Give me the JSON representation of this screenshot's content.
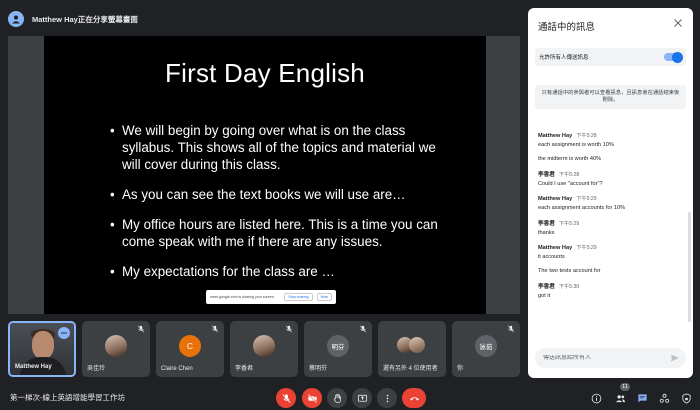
{
  "header": {
    "title": "Matthew Hay正在分享螢幕畫面"
  },
  "slide": {
    "title": "First Day English",
    "bullets": [
      "We will begin by going over what is on the class syllabus. This shows all of the topics and material we will cover during this class.",
      "As you can see the text books we will use are…",
      "My office hours are listed here. This is a time you can come speak with me if there are any issues.",
      "My expectations for the class are …"
    ],
    "share_bar": {
      "message": "meet.google.com is sharing your screen.",
      "stop_label": "Stop sharing",
      "hide_label": "Hide"
    }
  },
  "participants": [
    {
      "name": "Matthew Hay",
      "type": "video"
    },
    {
      "name": "吳佳玲",
      "type": "photo"
    },
    {
      "name": "Claire Chen",
      "type": "initial",
      "initial": "C",
      "color": "#e8710a"
    },
    {
      "name": "李香君",
      "type": "photo"
    },
    {
      "name": "蔡明芬",
      "type": "initial",
      "initial": "明芬",
      "color": "#5f6368"
    },
    {
      "name": "還有另外 4 位使用者",
      "type": "group"
    },
    {
      "name": "你",
      "type": "initial",
      "initial": "詠茹",
      "color": "#5f6368"
    }
  ],
  "bottom": {
    "meeting_name": "第一梯次-線上英語增能學習工作坊",
    "participant_count": "11"
  },
  "chat": {
    "title": "通話中的訊息",
    "allow_label": "允許所有人傳送訊息",
    "notice": "只有通話中的參與者可以查看訊息，且訊息會在通話結束後刪除。",
    "messages": [
      {
        "sender": "Matthew Hay",
        "time": "下午5:28",
        "lines": [
          "each assignment is worth 10%",
          "the midterm is worth 40%"
        ]
      },
      {
        "sender": "李香君",
        "time": "下午5:28",
        "lines": [
          "Could I use \"account for\"?"
        ]
      },
      {
        "sender": "Matthew Hay",
        "time": "下午5:29",
        "lines": [
          "each assignment accounts for 10%"
        ]
      },
      {
        "sender": "李香君",
        "time": "下午5:29",
        "lines": [
          "thanks"
        ]
      },
      {
        "sender": "Matthew Hay",
        "time": "下午5:29",
        "lines": [
          "it accounts",
          "The two tests account for"
        ]
      },
      {
        "sender": "李香君",
        "time": "下午5:30",
        "lines": [
          "got it"
        ]
      }
    ],
    "input_placeholder": "傳送訊息給所有人"
  },
  "colors": {
    "accent": "#8ab4f8",
    "danger": "#ea4335",
    "background": "#202124"
  }
}
